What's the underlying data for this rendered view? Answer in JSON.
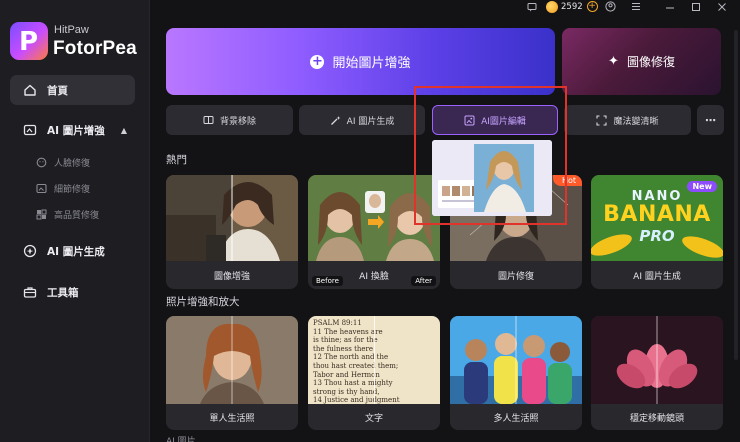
{
  "app": {
    "brand_small": "HitPaw",
    "brand_big": "FotorPea",
    "logo_letter": "P",
    "accent": "#8d4dff"
  },
  "topbar": {
    "credits": "2592",
    "icons": [
      "chat-icon",
      "coin-icon",
      "add-credits-icon",
      "user-icon",
      "menu-icon",
      "minimize-icon",
      "maximize-icon",
      "close-icon"
    ]
  },
  "sidebar": {
    "items": [
      {
        "label": "首頁",
        "icon": "home-icon",
        "active": true
      },
      {
        "label": "AI 圖片增強",
        "icon": "enhance-icon",
        "expanded": true
      },
      {
        "label": "AI 圖片生成",
        "icon": "ai-generate-icon"
      },
      {
        "label": "工具箱",
        "icon": "toolbox-icon"
      }
    ],
    "subitems": [
      {
        "label": "人臉修復",
        "icon": "face-icon"
      },
      {
        "label": "細節修復",
        "icon": "detail-icon"
      },
      {
        "label": "高品質修復",
        "icon": "quality-icon"
      }
    ]
  },
  "hero": {
    "main_label": "開始圖片增強",
    "side_label": "圖像修復"
  },
  "tools": [
    {
      "label": "背景移除",
      "icon": "background-remove-icon"
    },
    {
      "label": "AI 圖片生成",
      "icon": "ai-wand-icon"
    },
    {
      "label": "AI圖片編輯",
      "icon": "image-edit-icon",
      "highlighted": true
    },
    {
      "label": "魔法變清晰",
      "icon": "sharpen-icon"
    },
    {
      "label": "⋯",
      "icon": "more-icon"
    }
  ],
  "sections": {
    "hot_title": "熱門",
    "enlarge_title": "照片增強和放大",
    "next_title_cut": "AI 圖片..."
  },
  "hot_cards": [
    {
      "label": "圖像增強"
    },
    {
      "label": "AI 換臉",
      "tag_before": "Before",
      "tag_after": "After"
    },
    {
      "label": "圖片修復",
      "badge": "Hot"
    },
    {
      "label": "AI 圖片生成",
      "badge": "New",
      "art_line1": "NANO",
      "art_line2": "BANANA",
      "art_line3": "PRO"
    }
  ],
  "enlarge_cards": [
    {
      "label": "單人生活照"
    },
    {
      "label": "文字",
      "text_lines": [
        "PSALM 89:11",
        "11 The heavens are",
        "is thine; as for the",
        "the fulness there",
        "12 The north and the",
        "thou hast created them;",
        "Tabor and Hermon",
        "13 Thou hast a mighty",
        "strong is thy hand,",
        "14 Justice and judgment",
        "of thy throne: mercy"
      ]
    },
    {
      "label": "多人生活照"
    },
    {
      "label": "穩定移動鏡頭"
    }
  ]
}
